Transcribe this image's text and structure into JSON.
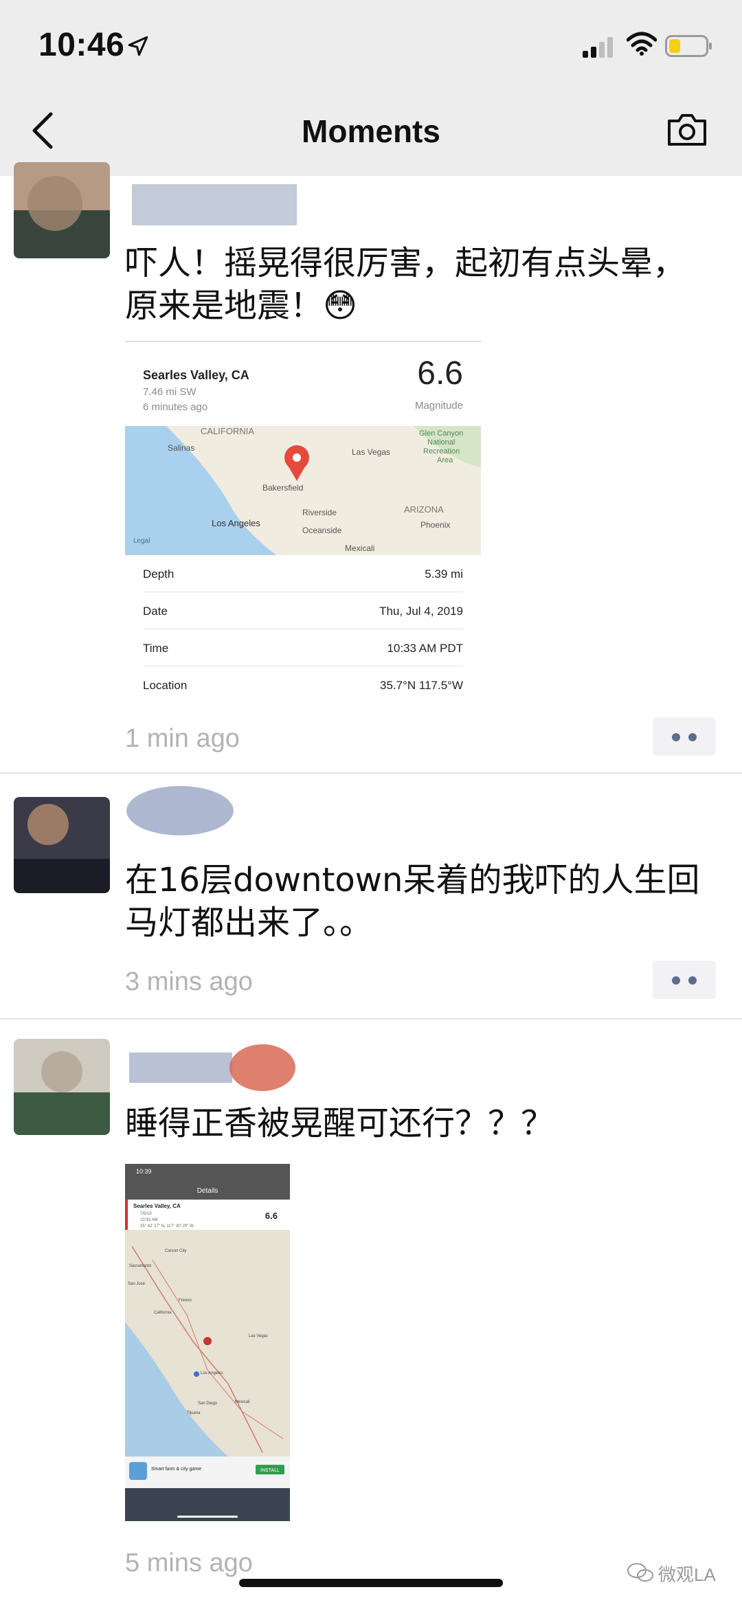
{
  "status_bar": {
    "time": "10:46"
  },
  "nav": {
    "title": "Moments"
  },
  "posts": [
    {
      "text_line1": "吓人！摇晃得很厉害，起初有点头晕，",
      "text_line2": "原来是地震！😳",
      "time": "1 min ago",
      "card": {
        "place": "Searles Valley, CA",
        "distance": "7.46 mi SW",
        "ago": "6 minutes ago",
        "magnitude": "6.6",
        "magnitude_label": "Magnitude",
        "map_labels": [
          "CALIFORNIA",
          "Salinas",
          "Las Vegas",
          "Glen Canyon",
          "National",
          "Recreation",
          "Area",
          "Bakersfield",
          "Riverside",
          "ARIZONA",
          "Los Angeles",
          "Phoenix",
          "Oceanside",
          "Legal",
          "Mexicali"
        ],
        "rows": [
          {
            "key": "Depth",
            "value": "5.39 mi"
          },
          {
            "key": "Date",
            "value": "Thu, Jul 4, 2019"
          },
          {
            "key": "Time",
            "value": "10:33 AM PDT"
          },
          {
            "key": "Location",
            "value": "35.7°N 117.5°W"
          }
        ]
      }
    },
    {
      "text_line1": "在16层downtown呆着的我吓的人生回",
      "text_line2": "马灯都出来了。。",
      "time": "3 mins ago"
    },
    {
      "text_line1": "睡得正香被晃醒可还行？？？",
      "time": "5 mins ago",
      "screenshot": {
        "status_time": "10:39",
        "header": "Details",
        "place": "Searles Valley, CA",
        "magnitude": "6.6",
        "line1": "7/5/19",
        "line2": "10:33 AM",
        "line3": "35° 42' 17\" N, 117° 30' 29\" W",
        "map_labels": [
          "Carson City",
          "Sacramento",
          "San Jose",
          "California",
          "Fresno",
          "Las Vegas",
          "Los Angeles",
          "San Diego",
          "Tijuana",
          "Mexicali"
        ],
        "ad_title": "Smart farm & city game",
        "ad_button": "INSTALL"
      }
    }
  ],
  "watermark": "微观LA"
}
